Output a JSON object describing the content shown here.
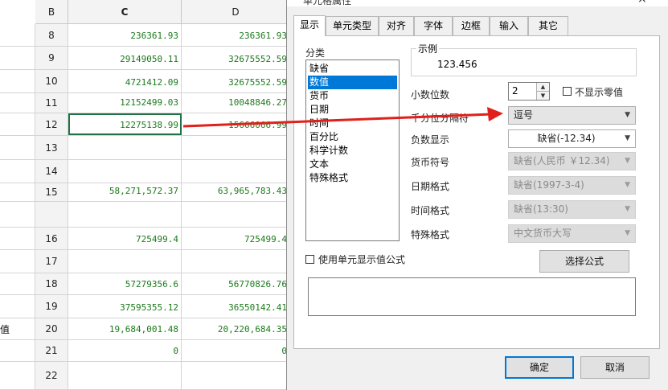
{
  "sheet": {
    "columns": [
      "B",
      "C",
      "D"
    ],
    "rows": [
      {
        "num": "8",
        "a": "",
        "c": "236361.93",
        "d": "236361.93"
      },
      {
        "num": "9",
        "a": "",
        "c": "29149050.11",
        "d": "32675552.59"
      },
      {
        "num": "10",
        "a": "",
        "c": "4721412.09",
        "d": "32675552.59"
      },
      {
        "num": "11",
        "a": "",
        "c": "12152499.03",
        "d": "10048846.27"
      },
      {
        "num": "12",
        "a": "",
        "c": "12275138.99",
        "d": "15666066.99"
      },
      {
        "num": "13",
        "a": "",
        "c": "",
        "d": ""
      },
      {
        "num": "14",
        "a": "",
        "c": "",
        "d": ""
      },
      {
        "num": "15",
        "a": "",
        "c": "58,271,572.37",
        "d": "63,965,783.43"
      },
      {
        "num": "",
        "a": "",
        "c": "",
        "d": ""
      },
      {
        "num": "16",
        "a": "",
        "c": "725499.4",
        "d": "725499.4"
      },
      {
        "num": "17",
        "a": "",
        "c": "",
        "d": ""
      },
      {
        "num": "18",
        "a": "",
        "c": "57279356.6",
        "d": "56770826.76"
      },
      {
        "num": "19",
        "a": "",
        "c": "37595355.12",
        "d": "36550142.41"
      },
      {
        "num": "20",
        "a": "值",
        "c": "19,684,001.48",
        "d": "20,220,684.35"
      },
      {
        "num": "21",
        "a": "",
        "c": "0",
        "d": "0"
      },
      {
        "num": "22",
        "a": "",
        "c": "",
        "d": ""
      }
    ]
  },
  "dialog": {
    "title": "单元格属性",
    "close": "×",
    "tabs": [
      "显示",
      "单元类型",
      "对齐",
      "字体",
      "边框",
      "输入",
      "其它"
    ],
    "category_label": "分类",
    "categories": [
      "缺省",
      "数值",
      "货币",
      "日期",
      "时间",
      "百分比",
      "科学计数",
      "文本",
      "特殊格式"
    ],
    "selected_category": "数值",
    "sample_label": "示例",
    "sample_value": "123.456",
    "decimal_label": "小数位数",
    "decimal_value": "2",
    "hide_zero_label": "不显示零值",
    "thousands_label": "千分位分隔符",
    "thousands_value": "逗号",
    "negative_label": "负数显示",
    "negative_value": "缺省(-12.34)",
    "currency_label": "货币符号",
    "currency_value": "缺省(人民币 ￥12.34)",
    "date_label": "日期格式",
    "date_value": "缺省(1997-3-4)",
    "time_label": "时间格式",
    "time_value": "缺省(13:30)",
    "special_label": "特殊格式",
    "special_value": "中文货币大写",
    "use_formula_label": "使用单元显示值公式",
    "choose_formula_button": "选择公式",
    "ok_button": "确定",
    "cancel_button": "取消"
  },
  "colors": {
    "number_text": "#1b7a1b",
    "selection": "#0078d7",
    "annotation_arrow": "#e0201a"
  }
}
